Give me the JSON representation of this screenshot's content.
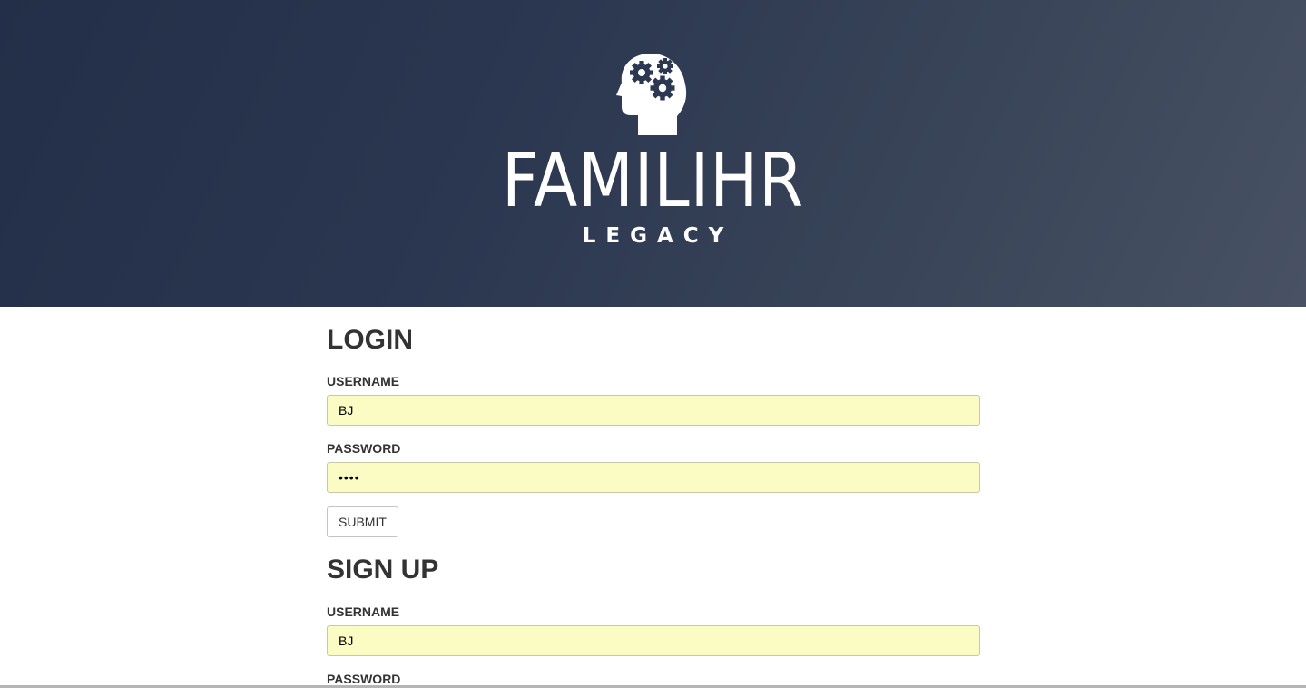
{
  "brand": {
    "name": "FAMILIHR",
    "tagline": "LEGACY",
    "logo_icon": "head-gears-icon"
  },
  "login": {
    "title": "LOGIN",
    "username_label": "USERNAME",
    "username_value": "BJ",
    "password_label": "PASSWORD",
    "password_value": "••••",
    "submit_label": "SUBMIT"
  },
  "signup": {
    "title": "SIGN UP",
    "username_label": "USERNAME",
    "username_value": "BJ",
    "password_label": "PASSWORD"
  },
  "colors": {
    "header_gradient_start": "#232f48",
    "header_gradient_end": "#485264",
    "autofill_background": "#fbfbc4",
    "text": "#333333"
  }
}
